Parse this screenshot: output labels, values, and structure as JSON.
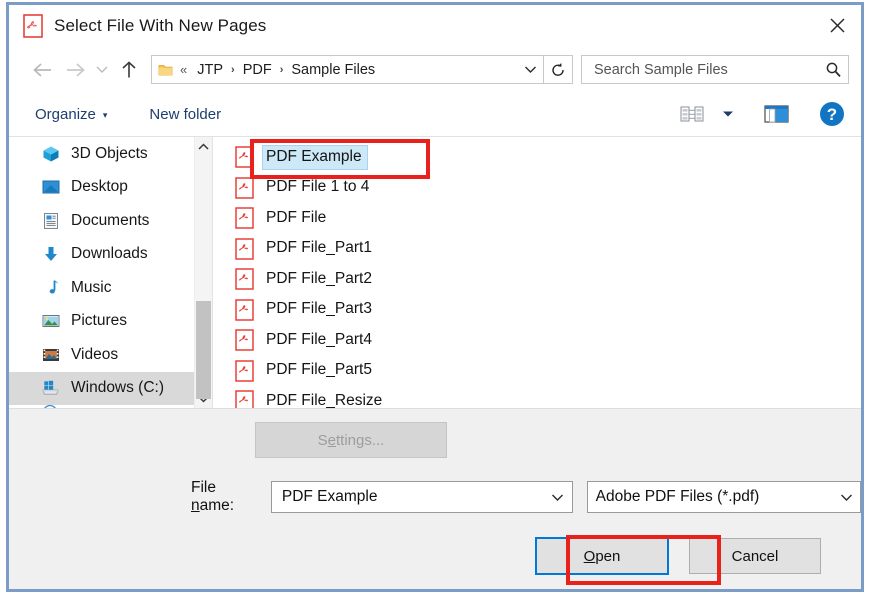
{
  "window": {
    "title": "Select File With New Pages",
    "title_icon": "pdf-file-icon",
    "close_label": "✕"
  },
  "nav": {
    "back_icon": "arrow-left-icon",
    "forward_icon": "arrow-right-icon",
    "history_icon": "chevron-down-icon",
    "up_icon": "arrow-up-icon",
    "refresh_icon": "refresh-icon",
    "address_dropdown_icon": "chevron-down-icon",
    "breadcrumb_prefix": "«",
    "breadcrumbs": [
      "JTP",
      "PDF",
      "Sample Files"
    ],
    "breadcrumb_separator": "›"
  },
  "search": {
    "placeholder": "Search Sample Files",
    "value": "",
    "icon": "search-icon"
  },
  "toolbar": {
    "organize_label": "Organize",
    "organize_caret": "▾",
    "new_folder_label": "New folder",
    "view_icon": "list-view-icon",
    "view_caret": "▾",
    "preview_pane_icon": "preview-pane-icon",
    "help_icon": "help-icon",
    "help_glyph": "?"
  },
  "sidebar": {
    "items": [
      {
        "label": "3D Objects",
        "icon": "3d-objects-icon",
        "selected": false
      },
      {
        "label": "Desktop",
        "icon": "desktop-icon",
        "selected": false
      },
      {
        "label": "Documents",
        "icon": "documents-icon",
        "selected": false
      },
      {
        "label": "Downloads",
        "icon": "downloads-icon",
        "selected": false
      },
      {
        "label": "Music",
        "icon": "music-icon",
        "selected": false
      },
      {
        "label": "Pictures",
        "icon": "pictures-icon",
        "selected": false
      },
      {
        "label": "Videos",
        "icon": "videos-icon",
        "selected": false
      },
      {
        "label": "Windows (C:)",
        "icon": "drive-icon",
        "selected": true
      }
    ],
    "scroll_up_icon": "chevron-up-icon",
    "scroll_down_icon": "chevron-down-icon"
  },
  "files": [
    {
      "name": "PDF Example",
      "icon": "pdf-file-icon",
      "selected": true
    },
    {
      "name": "PDF File 1 to 4",
      "icon": "pdf-file-icon",
      "selected": false
    },
    {
      "name": "PDF File",
      "icon": "pdf-file-icon",
      "selected": false
    },
    {
      "name": "PDF File_Part1",
      "icon": "pdf-file-icon",
      "selected": false
    },
    {
      "name": "PDF File_Part2",
      "icon": "pdf-file-icon",
      "selected": false
    },
    {
      "name": "PDF File_Part3",
      "icon": "pdf-file-icon",
      "selected": false
    },
    {
      "name": "PDF File_Part4",
      "icon": "pdf-file-icon",
      "selected": false
    },
    {
      "name": "PDF File_Part5",
      "icon": "pdf-file-icon",
      "selected": false
    },
    {
      "name": "PDF File_Resize",
      "icon": "pdf-file-icon",
      "selected": false
    }
  ],
  "footer": {
    "settings_label": "Settings...",
    "settings_accel": "e",
    "filename_label_pre": "File ",
    "filename_label_accel": "n",
    "filename_label_post": "ame:",
    "filename_value": "PDF Example",
    "filetype_value": "Adobe PDF Files (*.pdf)",
    "filetype_caret": "⌄",
    "open_label_accel": "O",
    "open_label_rest": "pen",
    "cancel_label": "Cancel"
  },
  "colors": {
    "window_border": "#7a9cc6",
    "accent_blue": "#0078d7",
    "annotation_red": "#e8211a",
    "pdf_red": "#e8413a",
    "selection_blue": "#cde8f7",
    "toolbar_link": "#1d3f6e"
  }
}
